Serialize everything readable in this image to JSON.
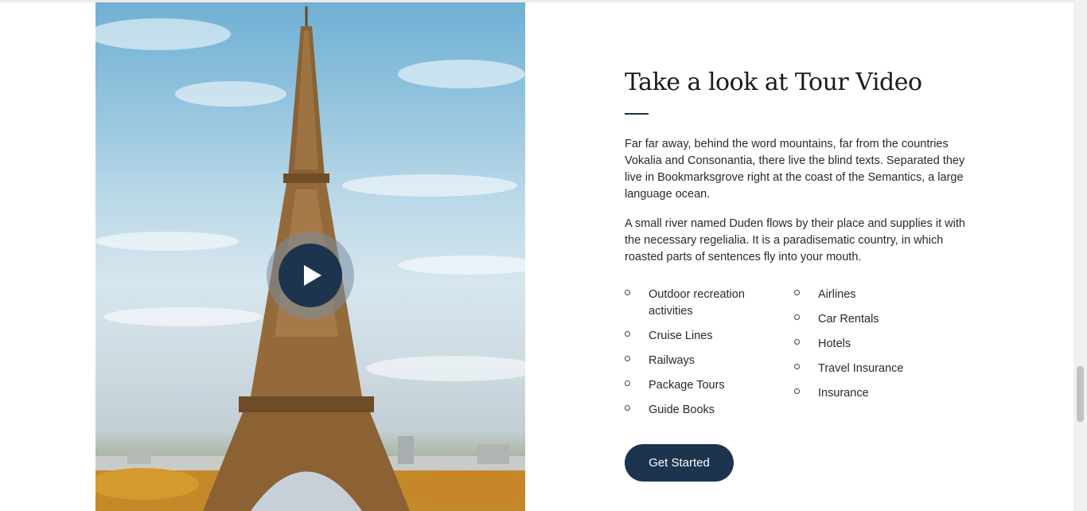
{
  "section": {
    "title": "Take a look at Tour Video",
    "paragraphs": [
      "Far far away, behind the word mountains, far from the countries Vokalia and Consonantia, there live the blind texts. Separated they live in Bookmarksgrove right at the coast of the Semantics, a large language ocean.",
      "A small river named Duden flows by their place and supplies it with the necessary regelialia. It is a paradisematic country, in which roasted parts of sentences fly into your mouth."
    ],
    "list_left": [
      "Outdoor recreation activities",
      "Cruise Lines",
      "Railways",
      "Package Tours",
      "Guide Books"
    ],
    "list_right": [
      "Airlines",
      "Car Rentals",
      "Hotels",
      "Travel Insurance",
      "Insurance"
    ],
    "cta_label": "Get Started"
  },
  "media": {
    "image_subject": "eiffel-tower",
    "play_icon": "play-icon"
  },
  "colors": {
    "accent": "#1c344e",
    "text": "#2a2a2a"
  }
}
